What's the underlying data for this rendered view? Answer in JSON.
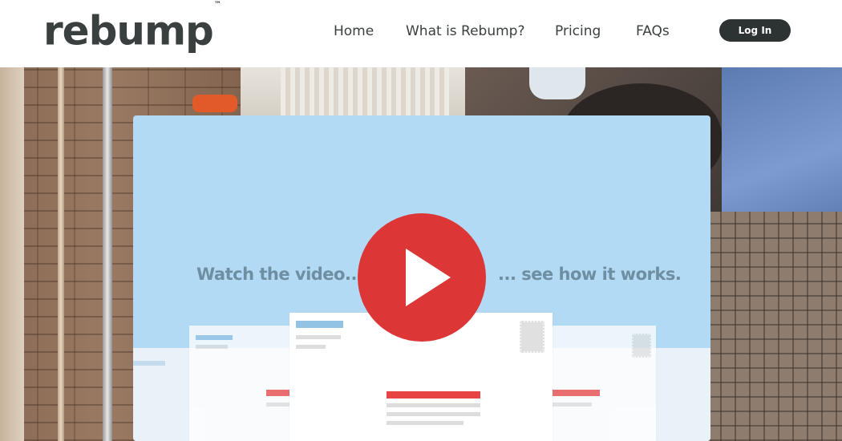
{
  "brand": {
    "name": "rebump",
    "trademark": "™"
  },
  "nav": {
    "items": [
      {
        "label": "Home"
      },
      {
        "label": "What is Rebump?"
      },
      {
        "label": "Pricing"
      },
      {
        "label": "FAQs"
      }
    ],
    "login_label": "Log In"
  },
  "hero": {
    "video_left_text": "Watch the video...",
    "video_right_text": "... see how it works.",
    "play_icon": "play-icon"
  },
  "colors": {
    "play_button": "#dc3636",
    "video_background": "#b3daf5",
    "login_button": "#2d3232"
  }
}
